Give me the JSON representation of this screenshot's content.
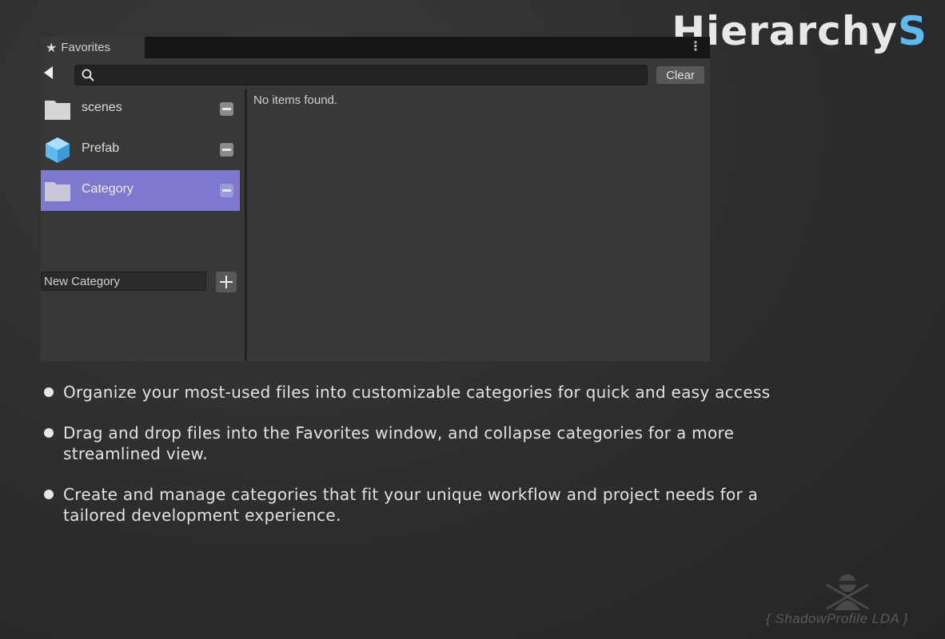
{
  "brand": {
    "name_main": "Hierarchy",
    "name_accent": "S",
    "accent_color": "#5fb8f0"
  },
  "window": {
    "tab": {
      "icon": "star-icon",
      "label": "Favorites"
    },
    "menu_icon": "kebab-menu-icon",
    "toolbar": {
      "back_icon": "triangle-left-icon",
      "search_placeholder": "",
      "clear_label": "Clear"
    },
    "categories": [
      {
        "label": "scenes",
        "icon": "folder-icon",
        "selected": false
      },
      {
        "label": "Prefab",
        "icon": "cube-icon",
        "selected": false
      },
      {
        "label": "Category",
        "icon": "folder-icon",
        "selected": true
      }
    ],
    "new_category_value": "New Category",
    "empty_message": "No items found.",
    "selected_color": "#7f78cf"
  },
  "features": [
    "Organize your most-used files into customizable categories for quick and easy access",
    "Drag and drop files into the Favorites window, and collapse categories for a more streamlined view.",
    "Create and manage categories that fit your unique workflow and project needs for a tailored development experience."
  ],
  "watermark": {
    "text": "{ ShadowProfile LDA }"
  }
}
